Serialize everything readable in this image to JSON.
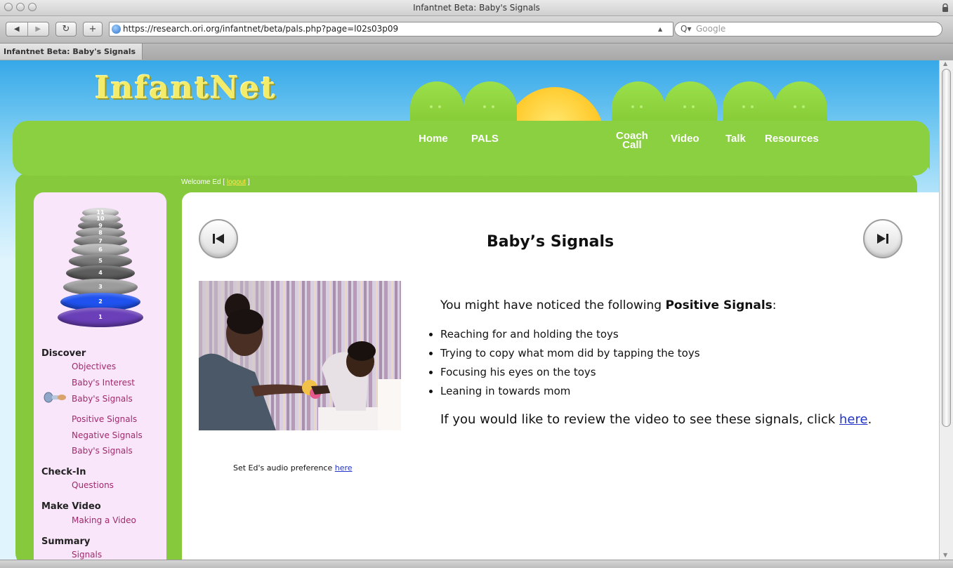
{
  "browser": {
    "window_title": "Infantnet Beta: Baby's Signals",
    "url": "https://research.ori.org/infantnet/beta/pals.php?page=l02s03p09",
    "search_placeholder": "Google",
    "tab_label": "Infantnet Beta: Baby's Signals",
    "icons": [
      "back-icon",
      "forward-icon",
      "reload-icon",
      "add-bookmark-icon",
      "globe-icon",
      "search-icon",
      "lock-icon"
    ]
  },
  "site": {
    "logo": "InfantNet",
    "nav": [
      {
        "label": "Home"
      },
      {
        "label": "PALS"
      },
      {
        "label_line1": "Coach",
        "label_line2": "Call"
      },
      {
        "label": "Video"
      },
      {
        "label": "Talk"
      },
      {
        "label": "Resources"
      }
    ],
    "welcome_prefix": "Welcome Ed [",
    "logout_label": "logout",
    "welcome_suffix": "]"
  },
  "sidebar": {
    "tower_levels": [
      "11",
      "10",
      "9",
      "8",
      "7",
      "6",
      "5",
      "4",
      "3",
      "2",
      "1"
    ],
    "sections": [
      {
        "title": "Discover",
        "items": [
          "Objectives",
          "Baby's Interest",
          "Baby's Signals",
          "Positive Signals",
          "Negative Signals",
          "Baby's Signals"
        ]
      },
      {
        "title": "Check-In",
        "items": [
          "Questions"
        ]
      },
      {
        "title": "Make Video",
        "items": [
          "Making a Video"
        ]
      },
      {
        "title": "Summary",
        "items": [
          "Signals"
        ]
      }
    ],
    "current_item_icon": "pacifier-icon"
  },
  "content": {
    "title": "Baby’s Signals",
    "prev_icon": "previous-page-icon",
    "next_icon": "next-page-icon",
    "audio_pref_text": "Set Ed's audio preference",
    "audio_pref_link": "here",
    "intro_prefix": "You might have noticed the following",
    "intro_bold": "Positive Signals",
    "intro_suffix": ":",
    "signals": [
      "Reaching for and holding the toys",
      "Trying to copy what mom did by tapping the toys",
      "Focusing his eyes on the toys",
      "Leaning in towards mom"
    ],
    "review_text": "If you would like to review the video to see these signals, click",
    "review_link": "here",
    "review_suffix": "."
  },
  "colors": {
    "sky": "#36a8e8",
    "green": "#8bd041",
    "sidebar_bg": "#fae6fa",
    "link_magenta": "#a0296b",
    "link_blue": "#2234c9",
    "logo_yellow": "#f3ec6a"
  }
}
